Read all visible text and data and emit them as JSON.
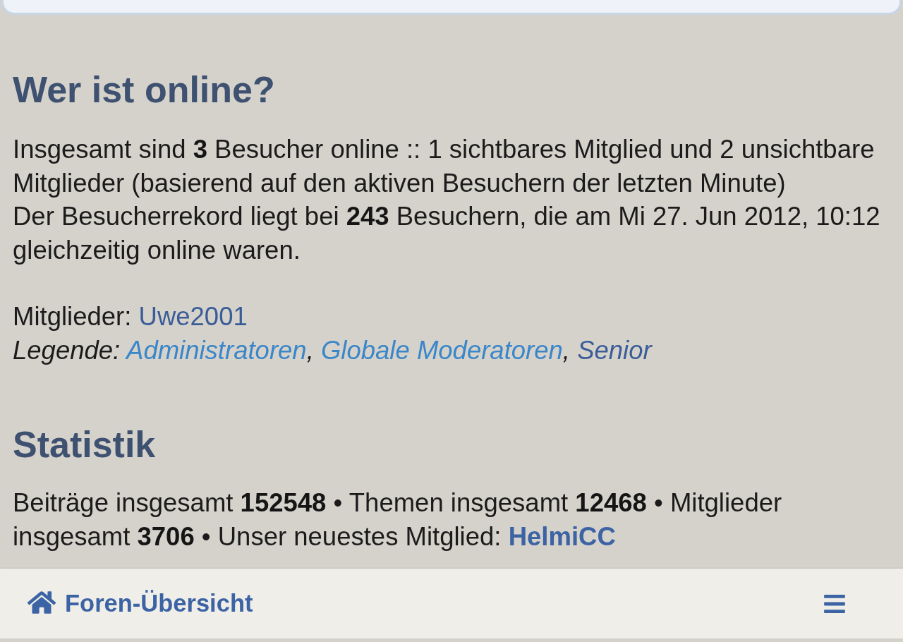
{
  "online": {
    "heading": "Wer ist online?",
    "summary": "Insgesamt sind **3** Besucher online :: 1 sichtbares Mitglied und 2 unsichtbare Mitglieder (basierend auf den aktiven Besuchern der letzten Minute)",
    "record": "Der Besucherrekord liegt bei **243** Besuchern, die am Mi 27. Jun 2012, 10:12 gleichzeitig online waren.",
    "members_label": "Mitglieder:",
    "members": [
      {
        "name": "Uwe2001",
        "color": "#3b5d97"
      }
    ],
    "legend_label": "Legende:",
    "legend_separator": ",",
    "legend": [
      {
        "name": "Administratoren",
        "color": "#3a86c8"
      },
      {
        "name": "Globale Moderatoren",
        "color": "#3a86c8"
      },
      {
        "name": "Senior",
        "color": "#3b5d97"
      }
    ]
  },
  "statistics": {
    "heading": "Statistik",
    "text": "Beiträge insgesamt **152548** • Themen insgesamt **12468** • Mitglieder insgesamt **3706** • Unser neuestes Mitglied:",
    "newest_member": "HelmiCC"
  },
  "footer": {
    "home_link": "Foren-Übersicht"
  }
}
